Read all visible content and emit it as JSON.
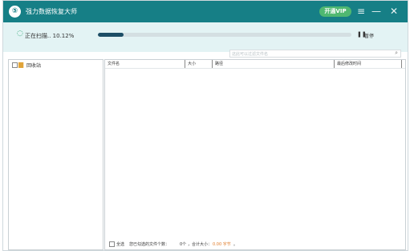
{
  "app": {
    "title": "强力数据恢复大师",
    "logo_glyph": "⑤",
    "vip_label": "开通VIP",
    "accent": "#167f86",
    "vip_color": "#4fb871"
  },
  "scan": {
    "status_text": "正在扫描.. 10.12%",
    "progress_fraction": 0.1012,
    "pause_label": "暂停"
  },
  "search": {
    "placeholder": "这此可以过滤文件名"
  },
  "tree": {
    "root_label": "回收站"
  },
  "table": {
    "headers": [
      "文件名",
      "大小",
      "路径",
      "最后修改时间"
    ],
    "rows": []
  },
  "footer": {
    "select_all_label": "全选",
    "prefix": "您已勾选的文件个数：",
    "count": "0个",
    "size_prefix": "，合计大小：",
    "size": "0.00 字节",
    "suffix": "。"
  }
}
